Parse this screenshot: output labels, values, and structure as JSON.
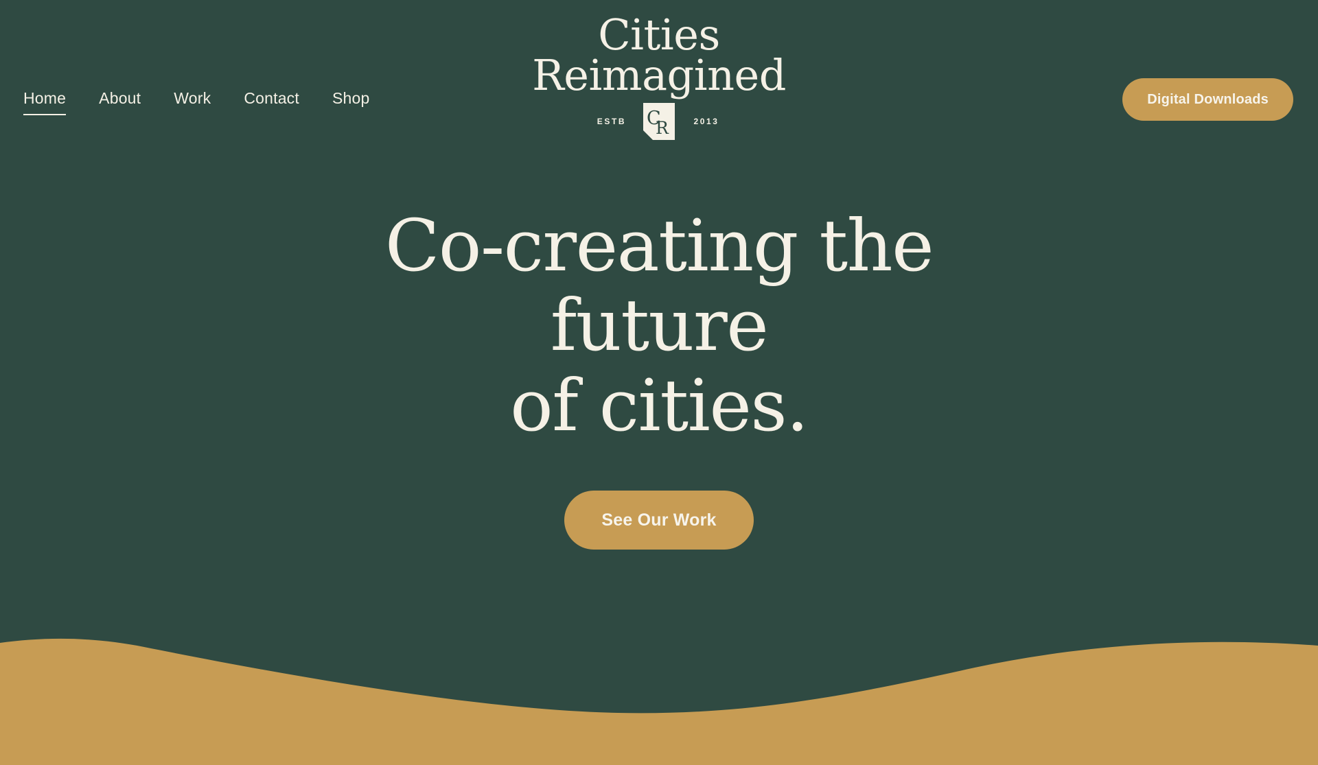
{
  "theme": {
    "background_green": "#2F4A42",
    "accent_gold": "#C79C54",
    "cream": "#F5F1E6"
  },
  "header": {
    "nav": [
      {
        "label": "Home",
        "active": true
      },
      {
        "label": "About",
        "active": false
      },
      {
        "label": "Work",
        "active": false
      },
      {
        "label": "Contact",
        "active": false
      },
      {
        "label": "Shop",
        "active": false
      }
    ],
    "logo": {
      "line1": "Cities",
      "line2": "Reimagined",
      "estb_label": "ESTB",
      "year": "2013",
      "monogram": "CR"
    },
    "cta": {
      "label": "Digital Downloads"
    }
  },
  "hero": {
    "title_line1": "Co-creating the future",
    "title_line2": "of cities.",
    "cta_label": "See Our Work"
  },
  "wave": {
    "fill": "#C79C54"
  }
}
